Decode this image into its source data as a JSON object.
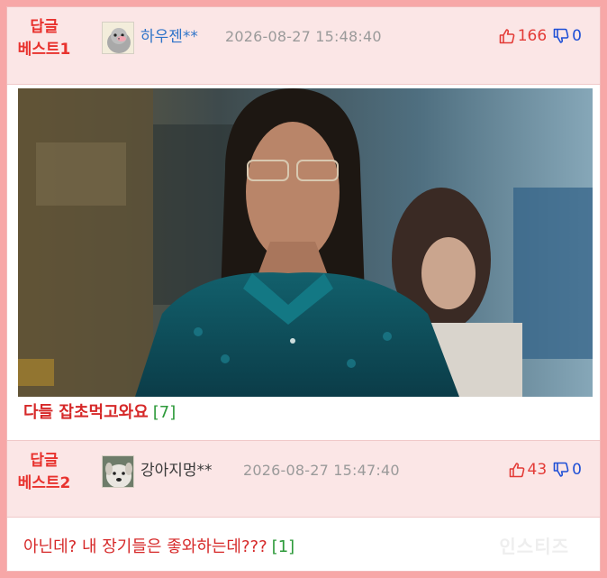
{
  "comments": [
    {
      "rank_line1": "답글",
      "rank_line2": "베스트1",
      "avatar_icon": "bird-avatar-icon",
      "nickname": "하우젠**",
      "datetime": "2026-08-27 15:48:40",
      "likes": "166",
      "dislikes": "0",
      "text": "다들 잡초먹고와요",
      "reply_count": "[7]"
    },
    {
      "rank_line1": "답글",
      "rank_line2": "베스트2",
      "avatar_icon": "dog-avatar-icon",
      "nickname": "강아지멍**",
      "datetime": "2026-08-27 15:47:40",
      "likes": "43",
      "dislikes": "0",
      "text": "아닌데? 내 장기들은 좋와하는데???",
      "reply_count": "[1]"
    }
  ],
  "watermark": "인스티즈",
  "colors": {
    "accent_red": "#e8322e",
    "like_red": "#e33b37",
    "dislike_blue": "#1e4fd6",
    "reply_count_green": "#2d9a3a",
    "header_bg": "#fbe6e6",
    "border_pink": "#f7a7a7"
  }
}
